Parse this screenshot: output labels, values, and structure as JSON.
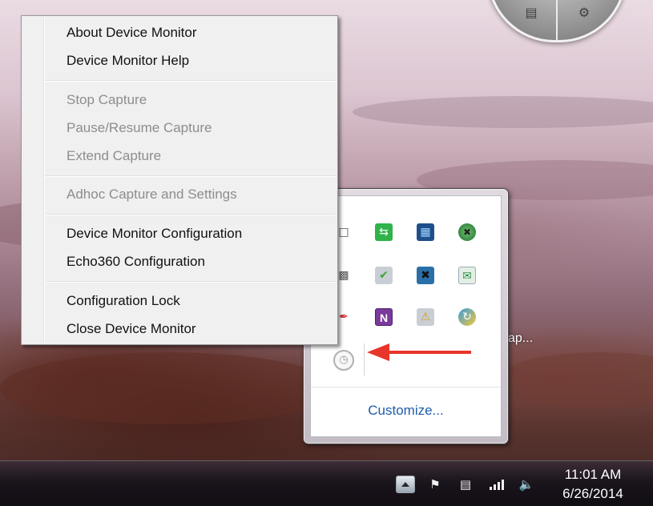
{
  "context_menu": {
    "items": [
      {
        "label": "About Device Monitor",
        "enabled": true
      },
      {
        "label": "Device Monitor Help",
        "enabled": true
      },
      {
        "label": "Stop Capture",
        "enabled": false
      },
      {
        "label": "Pause/Resume Capture",
        "enabled": false
      },
      {
        "label": "Extend Capture",
        "enabled": false
      },
      {
        "label": "Adhoc Capture and Settings",
        "enabled": false
      },
      {
        "label": "Device Monitor Configuration",
        "enabled": true
      },
      {
        "label": "Echo360 Configuration",
        "enabled": true
      },
      {
        "label": "Configuration Lock",
        "enabled": true
      },
      {
        "label": "Close Device Monitor",
        "enabled": true
      }
    ]
  },
  "tray_popup": {
    "customize_label": "Customize...",
    "icons": [
      "speech-bubble-icon",
      "green-arrows-icon",
      "monitor-icon",
      "globe-blocked-icon",
      "printer-icon",
      "drive-check-icon",
      "network-blocked-icon",
      "envelope-icon",
      "pen-icon",
      "onenote-icon",
      "warning-shield-icon",
      "update-icon",
      "device-monitor-icon"
    ],
    "onenote_letter": "N"
  },
  "desktop": {
    "peek_text": "ap..."
  },
  "taskbar": {
    "time": "11:01 AM",
    "date": "6/26/2014"
  },
  "colors": {
    "arrow": "#e8352a",
    "link": "#1e5ea8",
    "disabled_text": "#8d8d8d"
  }
}
